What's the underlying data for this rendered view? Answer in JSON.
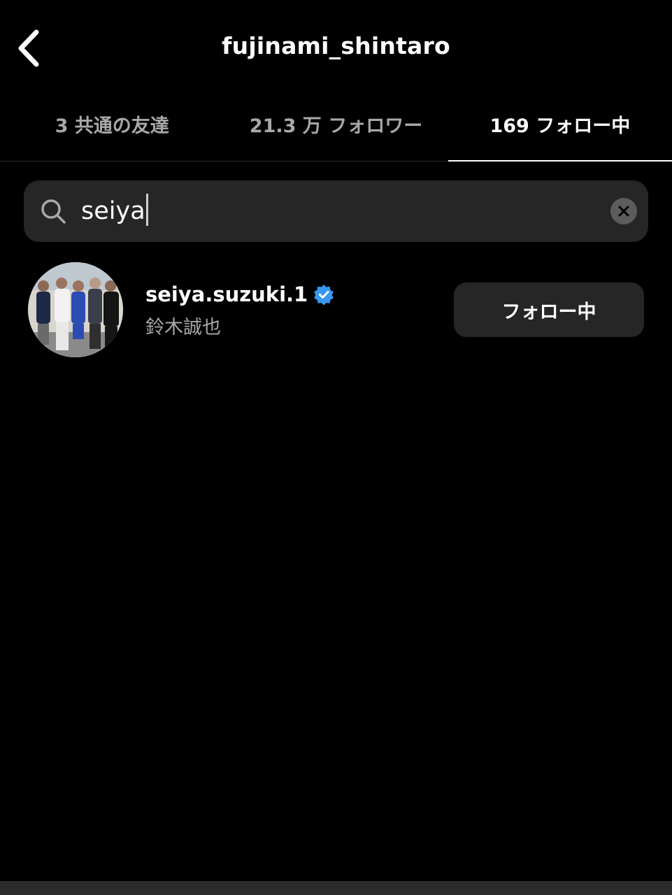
{
  "header": {
    "title": "fujinami_shintaro",
    "back_icon": "chevron-left-icon"
  },
  "tabs": [
    {
      "label": "3 共通の友達",
      "active": false
    },
    {
      "label": "21.3 万 フォロワー",
      "active": false
    },
    {
      "label": "169 フォロー中",
      "active": true
    }
  ],
  "search": {
    "value": "seiya",
    "icon": "search-icon",
    "clear_icon": "clear-icon"
  },
  "results": [
    {
      "username": "seiya.suzuki.1",
      "verified": true,
      "full_name": "鈴木誠也",
      "button_label": "フォロー中"
    }
  ],
  "colors": {
    "background": "#000000",
    "secondary_text": "#a8a8a8",
    "button_bg": "#262626",
    "verified_blue": "#3897f0"
  }
}
